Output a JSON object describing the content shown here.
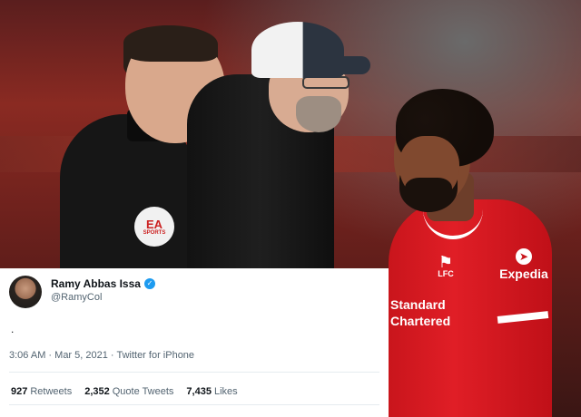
{
  "photo": {
    "jersey_crest": "LFC",
    "jersey_sponsor_right": "Expedia",
    "jersey_sponsor_front": [
      "Standard",
      "Chartered"
    ],
    "ref_badge": "EA",
    "ref_badge_sub": "SPORTS"
  },
  "tweet": {
    "display_name": "Ramy Abbas Issa",
    "handle": "@RamyCol",
    "text": ".",
    "time": "3:06 AM",
    "date": "Mar 5, 2021",
    "source": "Twitter for iPhone",
    "stats": {
      "retweets_count": "927",
      "retweets_label": "Retweets",
      "quotes_count": "2,352",
      "quotes_label": "Quote Tweets",
      "likes_count": "7,435",
      "likes_label": "Likes"
    }
  },
  "colors": {
    "verified": "#1d9bf0",
    "muted_text": "#536471",
    "jersey_red": "#e01e26"
  },
  "icons": [
    "verified-badge-icon",
    "avatar"
  ]
}
